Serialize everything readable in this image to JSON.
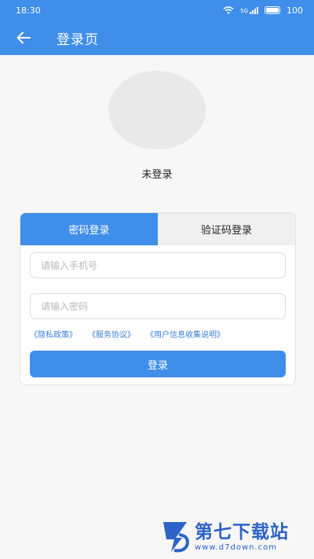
{
  "status_bar": {
    "time": "18:30",
    "battery": "100",
    "signal_text": "5G"
  },
  "header": {
    "title": "登录页"
  },
  "user": {
    "status": "未登录"
  },
  "tabs": [
    {
      "label": "密码登录",
      "active": true
    },
    {
      "label": "验证码登录",
      "active": false
    }
  ],
  "form": {
    "phone_placeholder": "请输入手机号",
    "password_placeholder": "请输入密码",
    "login_label": "登录"
  },
  "links": [
    "《隐私政策》",
    "《服务协议》",
    "《用户信息收集说明》"
  ],
  "watermark": {
    "name": "第七下载站",
    "url": "www.d7down.com"
  },
  "colors": {
    "accent": "#3f8ee9",
    "link": "#3a7fd5",
    "watermark": "#2c63c8"
  }
}
